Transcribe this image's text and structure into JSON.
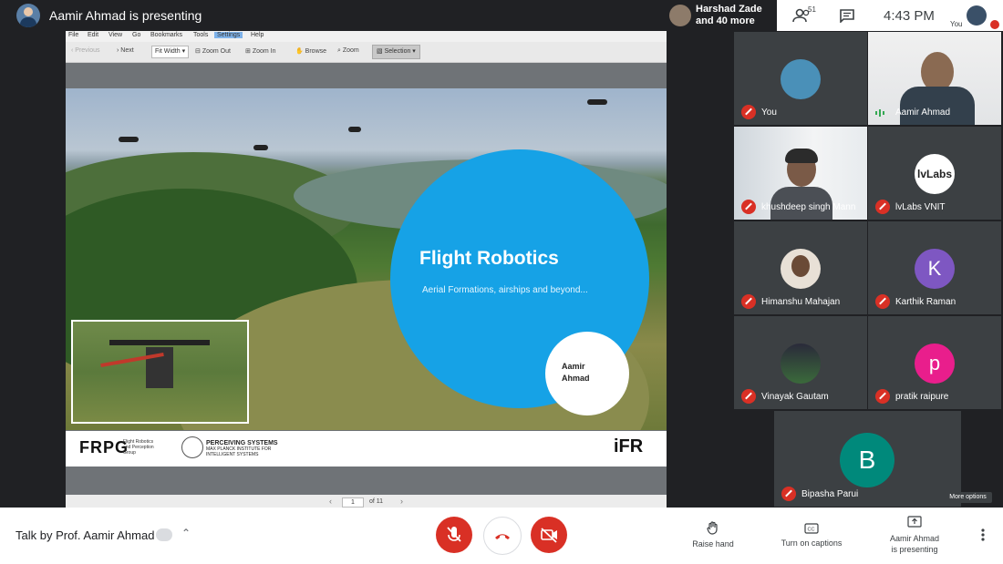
{
  "header": {
    "presenting_title": "Aamir Ahmad is presenting",
    "others_line1": "Harshad Zade",
    "others_line2": "and 40 more",
    "people_count": "51",
    "clock": "4:43 PM",
    "me_label": "You"
  },
  "viewer": {
    "menu": [
      "File",
      "Edit",
      "View",
      "Go",
      "Bookmarks",
      "Tools",
      "Settings",
      "Help"
    ],
    "toolbar": {
      "previous": "Previous",
      "next": "Next",
      "fit": "Fit Width",
      "zoom_out": "Zoom Out",
      "zoom_in": "Zoom In",
      "browse": "Browse",
      "zoom": "Zoom",
      "selection": "Selection"
    },
    "pager": {
      "page": "1",
      "of": "of",
      "total": "11"
    }
  },
  "slide": {
    "title": "Flight Robotics",
    "subtitle": "Aerial Formations, airships and beyond...",
    "author_line1": "Aamir",
    "author_line2": "Ahmad",
    "logo_frpg": "FRPG",
    "logo_frpg_sub": "Flight Robotics and Perception Group",
    "logo_mpi_line1": "PERCEIVING SYSTEMS",
    "logo_mpi_line2": "MAX PLANCK INSTITUTE FOR",
    "logo_mpi_line3": "INTELLIGENT SYSTEMS",
    "logo_ifr": "iFR"
  },
  "participants": [
    {
      "name": "You"
    },
    {
      "name": "Aamir Ahmad"
    },
    {
      "name": "khushdeep singh Mann"
    },
    {
      "name": "lvLabs VNIT",
      "avatar_text": "lvLabs"
    },
    {
      "name": "Himanshu Mahajan"
    },
    {
      "name": "Karthik Raman",
      "letter": "K",
      "color": "#7e57c2"
    },
    {
      "name": "Vinayak Gautam"
    },
    {
      "name": "pratik raipure",
      "letter": "p",
      "color": "#e91e8c"
    },
    {
      "name": "Bipasha Parui",
      "letter": "B",
      "color": "#00897b"
    }
  ],
  "footer": {
    "meeting_title": "Talk by Prof. Aamir Ahmad",
    "more_options": "More options",
    "raise_hand": "Raise hand",
    "captions": "Turn on captions",
    "presenting_line1": "Aamir Ahmad",
    "presenting_line2": "is presenting"
  },
  "colors": {
    "danger": "#d93025",
    "slide_blue": "#16a2e6"
  }
}
